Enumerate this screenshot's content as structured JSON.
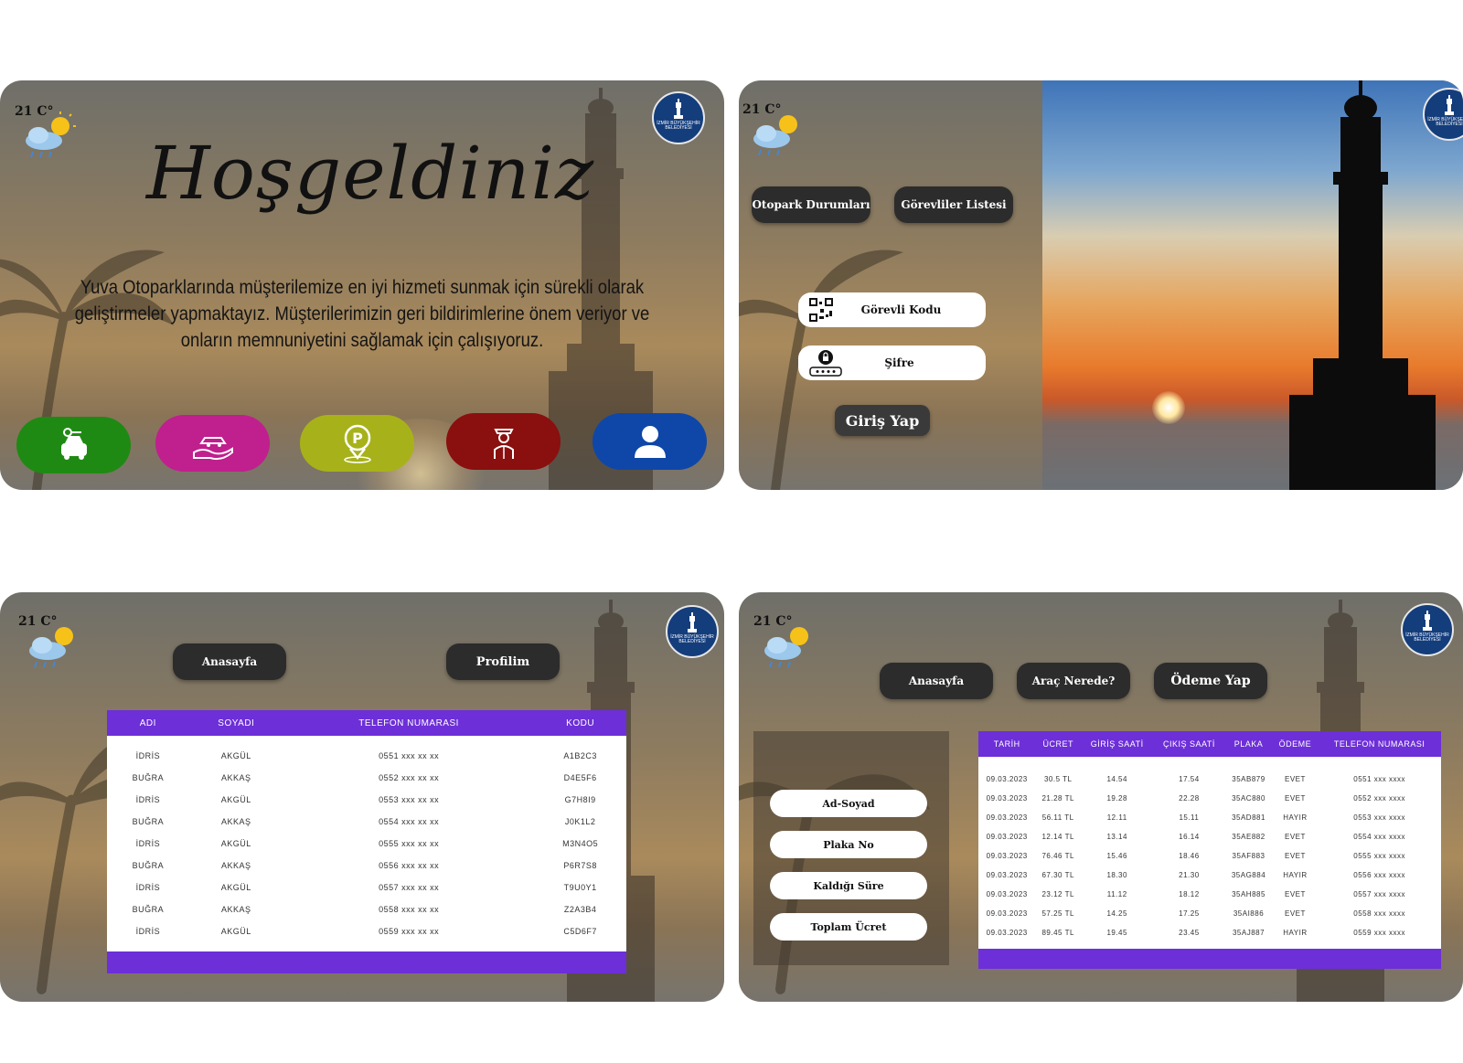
{
  "weather": {
    "temp": "21 C°"
  },
  "logo": {
    "text": "İZMİR BÜYÜKŞEHİR BELEDİYESİ"
  },
  "welcome": {
    "title": "Hoşgeldiniz",
    "description": "Yuva Otoparklarında müşterilemize en iyi hizmeti sunmak için sürekli olarak geliştirmeler yapmaktayız. Müşterilerimizin geri bildirimlerine önem veriyor ve onların memnuniyetini sağlamak için çalışıyoruz.",
    "buttons": [
      {
        "icon": "car-key-icon",
        "color": "#1f8a13"
      },
      {
        "icon": "car-hand-icon",
        "color": "#c01f8e"
      },
      {
        "icon": "parking-location-icon",
        "color": "#a7b21a"
      },
      {
        "icon": "attendant-icon",
        "color": "#8a0f0f"
      },
      {
        "icon": "user-icon",
        "color": "#0f47a8"
      }
    ]
  },
  "login": {
    "otopark_button": "Otopark Durumları",
    "gorevliler_button": "Görevliler Listesi",
    "code_placeholder": "Görevli Kodu",
    "password_placeholder": "Şifre",
    "login_button": "Giriş Yap"
  },
  "staff": {
    "home_button": "Anasayfa",
    "profile_button": "Profilim",
    "columns": [
      "ADI",
      "SOYADI",
      "TELEFON NUMARASI",
      "KODU"
    ],
    "rows": [
      [
        "İDRİS",
        "AKGÜL",
        "0551 xxx xx xx",
        "A1B2C3"
      ],
      [
        "BUĞRA",
        "AKKAŞ",
        "0552 xxx xx xx",
        "D4E5F6"
      ],
      [
        "İDRİS",
        "AKGÜL",
        "0553 xxx xx xx",
        "G7H8I9"
      ],
      [
        "BUĞRA",
        "AKKAŞ",
        "0554 xxx xx xx",
        "J0K1L2"
      ],
      [
        "İDRİS",
        "AKGÜL",
        "0555 xxx xx xx",
        "M3N4O5"
      ],
      [
        "BUĞRA",
        "AKKAŞ",
        "0556 xxx xx xx",
        "P6R7S8"
      ],
      [
        "İDRİS",
        "AKGÜL",
        "0557 xxx xx xx",
        "T9U0Y1"
      ],
      [
        "BUĞRA",
        "AKKAŞ",
        "0558 xxx xx xx",
        "Z2A3B4"
      ],
      [
        "İDRİS",
        "AKGÜL",
        "0559 xxx xx xx",
        "C5D6F7"
      ]
    ]
  },
  "records": {
    "home_button": "Anasayfa",
    "where_button": "Araç Nerede?",
    "pay_button": "Ödeme Yap",
    "side_buttons": [
      "Ad-Soyad",
      "Plaka No",
      "Kaldığı Süre",
      "Toplam Ücret"
    ],
    "columns": [
      "TARİH",
      "ÜCRET",
      "GİRİŞ SAATİ",
      "ÇIKIŞ SAATİ",
      "PLAKA",
      "ÖDEME",
      "TELEFON NUMARASI"
    ],
    "rows": [
      [
        "09.03.2023",
        "30.5 TL",
        "14.54",
        "17.54",
        "35AB879",
        "EVET",
        "0551 xxx xxxx"
      ],
      [
        "09.03.2023",
        "21.28 TL",
        "19.28",
        "22.28",
        "35AC880",
        "EVET",
        "0552 xxx xxxx"
      ],
      [
        "09.03.2023",
        "56.11 TL",
        "12.11",
        "15.11",
        "35AD881",
        "HAYIR",
        "0553 xxx xxxx"
      ],
      [
        "09.03.2023",
        "12.14 TL",
        "13.14",
        "16.14",
        "35AE882",
        "EVET",
        "0554 xxx xxxx"
      ],
      [
        "09.03.2023",
        "76.46 TL",
        "15.46",
        "18.46",
        "35AF883",
        "EVET",
        "0555 xxx xxxx"
      ],
      [
        "09.03.2023",
        "67.30 TL",
        "18.30",
        "21.30",
        "35AG884",
        "HAYIR",
        "0556 xxx xxxx"
      ],
      [
        "09.03.2023",
        "23.12 TL",
        "11.12",
        "18.12",
        "35AH885",
        "EVET",
        "0557 xxx xxxx"
      ],
      [
        "09.03.2023",
        "57.25 TL",
        "14.25",
        "17.25",
        "35AI886",
        "EVET",
        "0558 xxx xxxx"
      ],
      [
        "09.03.2023",
        "89.45 TL",
        "19.45",
        "23.45",
        "35AJ887",
        "HAYIR",
        "0559 xxx xxxx"
      ]
    ]
  }
}
